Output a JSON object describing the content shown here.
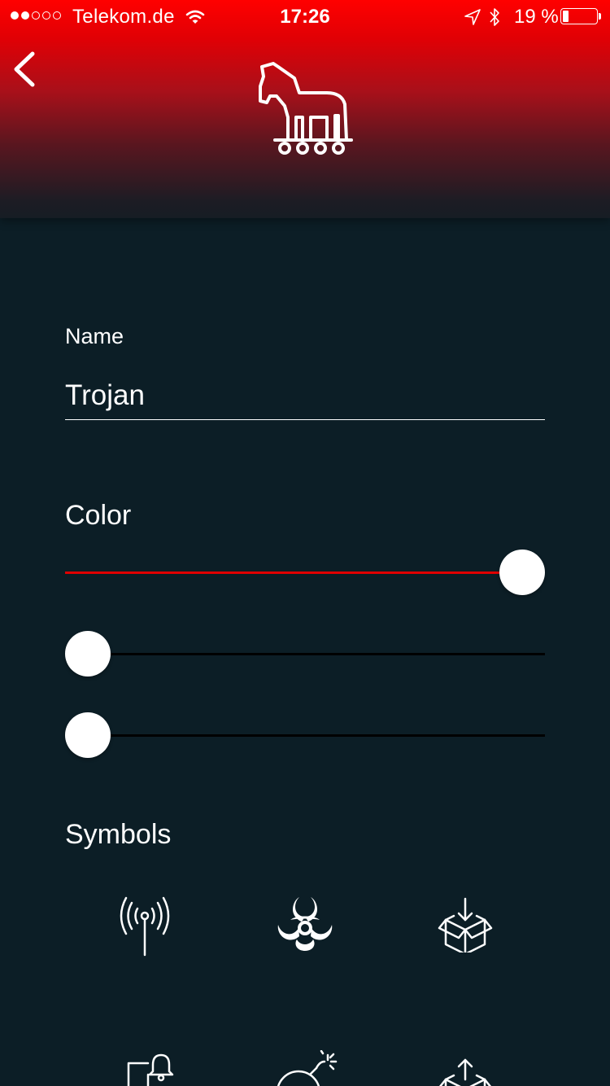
{
  "status_bar": {
    "carrier": "Telekom.de",
    "time": "17:26",
    "battery_percent": "19 %",
    "battery_level": 0.19,
    "signal_bars_filled": 2,
    "signal_bars_total": 5
  },
  "header": {
    "back_icon": "chevron-left-icon",
    "selected_symbol_icon": "trojan-horse-icon"
  },
  "form": {
    "name_label": "Name",
    "name_value": "Trojan",
    "color_label": "Color",
    "sliders": [
      {
        "value": 1.0,
        "fill_color": "#e00000"
      },
      {
        "value": 0.0,
        "fill_color": "#000000"
      },
      {
        "value": 0.0,
        "fill_color": "#000000"
      }
    ],
    "symbols_label": "Symbols"
  },
  "symbols": [
    "antenna-icon",
    "biohazard-icon",
    "box-download-icon",
    "door-bell-icon",
    "bomb-icon",
    "box-upload-icon"
  ],
  "colors": {
    "background": "#0c1e26",
    "accent": "#ff0000",
    "text": "#ffffff"
  }
}
